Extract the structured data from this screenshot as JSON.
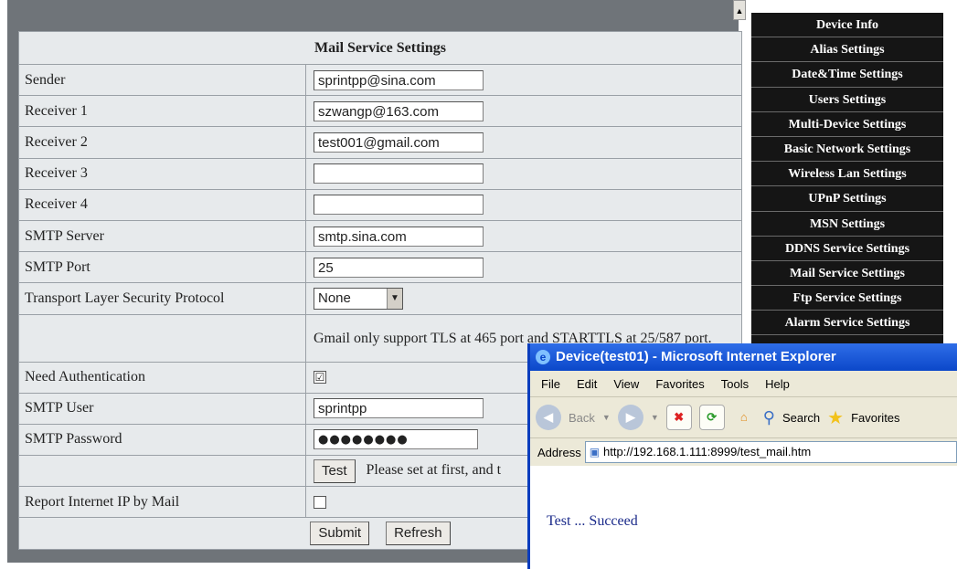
{
  "form": {
    "title": "Mail Service Settings",
    "rows": {
      "sender": {
        "label": "Sender",
        "value": "sprintpp@sina.com"
      },
      "receiver1": {
        "label": "Receiver 1",
        "value": "szwangp@163.com"
      },
      "receiver2": {
        "label": "Receiver 2",
        "value": "test001@gmail.com"
      },
      "receiver3": {
        "label": "Receiver 3",
        "value": ""
      },
      "receiver4": {
        "label": "Receiver 4",
        "value": ""
      },
      "smtp_server": {
        "label": "SMTP Server",
        "value": "smtp.sina.com"
      },
      "smtp_port": {
        "label": "SMTP Port",
        "value": "25"
      },
      "tls": {
        "label": "Transport Layer Security Protocol",
        "value": "None"
      },
      "note": "Gmail only support TLS at 465 port and STARTTLS at 25/587 port.",
      "need_auth": {
        "label": "Need Authentication",
        "checked": "☑"
      },
      "smtp_user": {
        "label": "SMTP User",
        "value": "sprintpp"
      },
      "smtp_password": {
        "label": "SMTP Password",
        "value": "●●●●●●●●"
      },
      "test": {
        "button": "Test",
        "hint": "Please set at first, and t"
      },
      "report_ip": {
        "label": "Report Internet IP by Mail",
        "checked": ""
      }
    },
    "submit_label": "Submit",
    "refresh_label": "Refresh"
  },
  "nav": {
    "items": [
      "Device Info",
      "Alias Settings",
      "Date&Time Settings",
      "Users Settings",
      "Multi-Device Settings",
      "Basic Network Settings",
      "Wireless Lan Settings",
      "UPnP Settings",
      "MSN Settings",
      "DDNS Service Settings",
      "Mail Service Settings",
      "Ftp Service Settings",
      "Alarm Service Settings"
    ]
  },
  "popup": {
    "title": "Device(test01) - Microsoft Internet Explorer",
    "menu": [
      "File",
      "Edit",
      "View",
      "Favorites",
      "Tools",
      "Help"
    ],
    "toolbar": {
      "back": "Back",
      "search": "Search",
      "favorites": "Favorites"
    },
    "address_label": "Address",
    "address": "http://192.168.1.111:8999/test_mail.htm",
    "body_text": "Test ... Succeed"
  },
  "icons": {
    "back": "back-arrow-icon",
    "forward": "forward-arrow-icon",
    "stop": "stop-icon",
    "refresh": "refresh-icon",
    "home": "home-icon",
    "search": "search-icon",
    "favorites": "star-icon",
    "ie": "internet-explorer-icon"
  }
}
